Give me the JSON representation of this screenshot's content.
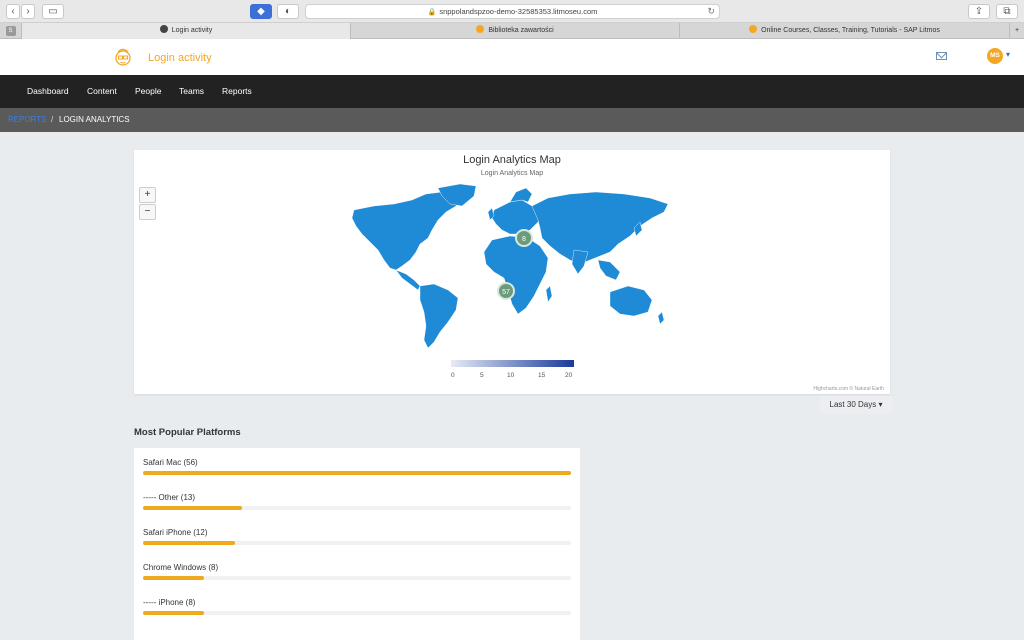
{
  "browser": {
    "url": "snppolandspzoo-demo-32585353.litmoseu.com",
    "tabs": [
      {
        "label": "Login activity"
      },
      {
        "label": "Biblioteka zawartości"
      },
      {
        "label": "Online Courses, Classes, Training, Tutorials - SAP Litmos"
      }
    ]
  },
  "header": {
    "title": "Login activity",
    "avatar_initials": "MS"
  },
  "nav": {
    "items": [
      {
        "label": "Dashboard"
      },
      {
        "label": "Content"
      },
      {
        "label": "People"
      },
      {
        "label": "Teams"
      },
      {
        "label": "Reports"
      }
    ]
  },
  "breadcrumb": {
    "parent": "REPORTS",
    "separator": "/",
    "current": "LOGIN ANALYTICS"
  },
  "map": {
    "title": "Login Analytics Map",
    "subtitle": "Login Analytics Map",
    "zoom_in": "+",
    "zoom_out": "−",
    "markers": [
      {
        "value": "8"
      },
      {
        "value": "57"
      }
    ],
    "legend": {
      "min": 0,
      "max": 20,
      "labels": [
        "0",
        "5",
        "10",
        "15",
        "20"
      ],
      "color_low": "#e6ebf5",
      "color_high": "#1a3a9b"
    },
    "land_color": "#1f8ad6",
    "credits": "Highcharts.com © Natural Earth"
  },
  "range_selector": {
    "label": "Last 30 Days ▾"
  },
  "platforms": {
    "title": "Most Popular Platforms",
    "bar_color": "#f0a81c",
    "items": [
      {
        "label": "Safari Mac (56)",
        "percent": 100
      },
      {
        "label": "----- Other (13)",
        "percent": 23.2
      },
      {
        "label": "Safari iPhone (12)",
        "percent": 21.4
      },
      {
        "label": "Chrome Windows (8)",
        "percent": 14.3
      },
      {
        "label": "----- iPhone (8)",
        "percent": 14.3
      }
    ]
  }
}
